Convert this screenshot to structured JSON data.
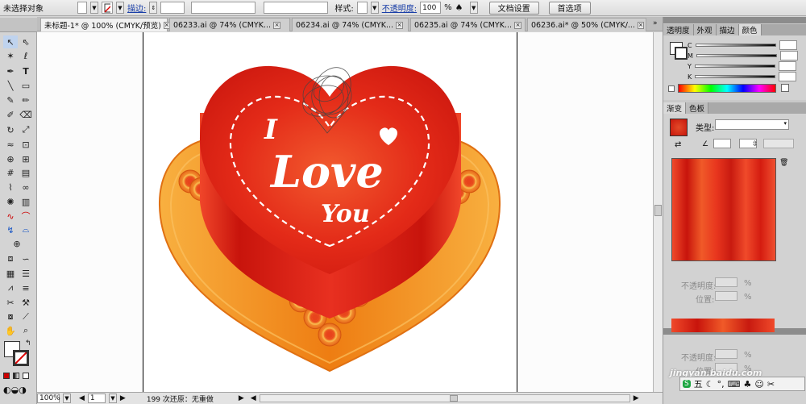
{
  "control_bar": {
    "selection_label": "未选择对象",
    "stroke_label": "描边:",
    "style_label": "样式:",
    "opacity_label": "不透明度:",
    "opacity_value": "100",
    "percent": "%",
    "doc_setup_button": "文档设置",
    "prefs_button": "首选项"
  },
  "tabs": [
    {
      "label": "未标题-1* @ 100% (CMYK/预览)",
      "active": true
    },
    {
      "label": "06233.ai @ 74% (CMYK...",
      "active": false
    },
    {
      "label": "06234.ai @ 74% (CMYK...",
      "active": false
    },
    {
      "label": "06235.ai @ 74% (CMYK...",
      "active": false
    },
    {
      "label": "06236.ai* @ 50% (CMYK/..."
    }
  ],
  "artwork": {
    "line1": "I",
    "line2": "Love",
    "line3": "You"
  },
  "status": {
    "zoom": "100%",
    "page": "1",
    "undo_text": "199 次还原：无重做"
  },
  "color_panel": {
    "tabs": [
      "透明度",
      "外观",
      "描边",
      "颜色"
    ],
    "channels": [
      "C",
      "M",
      "Y",
      "K"
    ]
  },
  "gradient_panel": {
    "tabs": [
      "渐变",
      "色板"
    ],
    "type_label": "类型:",
    "opacity_label": "不透明度:",
    "location_label": "位置:",
    "percent": "%"
  },
  "watermark": {
    "text": "jingyan.baidu.com"
  },
  "ime_bar": {
    "label": "五",
    "icons": [
      "ime-logo-icon",
      "moon-icon",
      "punct-icon",
      "keyboard-icon",
      "skin-icon",
      "user-icon",
      "settings-icon"
    ]
  },
  "colors": {
    "heart_red": "#e0261a",
    "plate_orange": "#f08a1e",
    "ui_panel": "#c9c9c9"
  }
}
